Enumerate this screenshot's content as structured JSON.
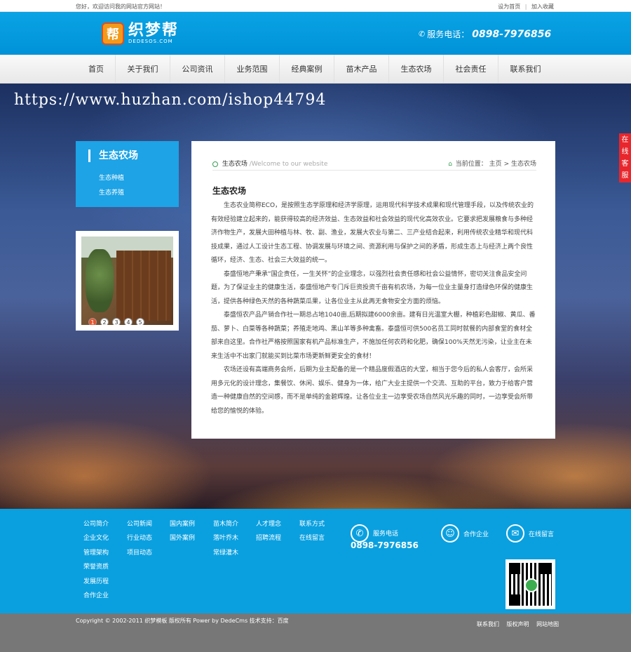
{
  "topbar": {
    "welcome": "您好，欢迎访问我的网站官方网站！",
    "set_home": "设为首页",
    "separator": "|",
    "add_favorite": "加入收藏"
  },
  "header": {
    "logo_mark": "帮",
    "logo_name": "织梦帮",
    "logo_domain": "DEDESOS.COM",
    "phone_label": "服务电话：",
    "phone_number": "0898-7976856"
  },
  "nav": {
    "items": [
      "首页",
      "关于我们",
      "公司资讯",
      "业务范围",
      "经典案例",
      "苗木产品",
      "生态农场",
      "社会责任",
      "联系我们"
    ]
  },
  "watermark": "https://www.huzhan.com/ishop44794",
  "sidebar": {
    "title": "生态农场",
    "items": [
      "生态种植",
      "生态养殖"
    ]
  },
  "slider": {
    "dots": [
      "1",
      "2",
      "3",
      "4",
      "5"
    ],
    "active": 1
  },
  "content": {
    "section_title": "生态农场",
    "section_subtitle": "/Welcome to our website",
    "location_label": "当前位置：",
    "crumb_home": "主页",
    "crumb_sep": ">",
    "crumb_current": "生态农场",
    "heading": "生态农场",
    "paragraphs": [
      "生态农业简称ECO，是按照生态学原理和经济学原理，运用现代科学技术成果和现代管理手段，以及传统农业的有效经验建立起来的，能获得较高的经济效益、生态效益和社会效益的现代化高效农业。它要求把发展粮食与多种经济作物生产，发展大田种植与林、牧、副、渔业，发展大农业与第二、三产业结合起来，利用传统农业精华和现代科技成果，通过人工设计生态工程、协调发展与环境之间、资源利用与保护之间的矛盾，形成生态上与经济上两个良性循环，经济、生态、社会三大效益的统一。",
      "泰盛恒地产秉承“国企责任，一生关怀”的企业理念，以强烈社会责任感和社会公益情怀，密切关注食品安全问题，为了保证业主的健康生活，泰盛恒地产专门斥巨资投资千亩有机农场，为每一位业主量身打造绿色环保的健康生活，提供各种绿色天然的各种蔬菜瓜果，让各位业主从此再无食物安全方面的烦恼。",
      "泰盛恒农产品产销合作社一期总占地1040亩,后期拟建6000余亩。建有日光温室大棚，种植彩色甜椒、黄瓜、番茄、萝卜、白菜等各种蔬菜；养殖走地鸡、黑山羊等多种禽畜。泰盛恒可供500名员工同时就餐的内部食堂的食材全部来自这里。合作社严格按照国家有机产品标准生产，不施加任何农药和化肥，确保100%天然无污染，让业主在未来生活中不出家门就能买到比菜市场更新鲜更安全的食材！",
      "农场还设有高端商务会所，后期为业主配备的是一个精品度假酒店的大堂，相当于您今后的私人会客厅，会所采用多元化的设计理念，集餐饮、休闲、娱乐、健身为一体，给广大业主提供一个交流、互助的平台，致力于给客户营造一种健康自然的空间感，而不是单纯的金碧辉煌。让各位业主一边享受农场自然风光乐趣的同时，一边享受会所带给您的愉悦的体验。"
    ]
  },
  "chat": "在线客服",
  "footer": {
    "col1": [
      "公司简介",
      "企业文化",
      "管理架构",
      "荣誉资质",
      "发展历程",
      "合作企业"
    ],
    "col2": [
      "公司新闻",
      "行业动态",
      "项目动态"
    ],
    "col3": [
      "国内案例",
      "国外案例"
    ],
    "col4": [
      "苗木简介",
      "落叶乔木",
      "常绿灌木"
    ],
    "col5": [
      "人才理念",
      "招聘流程"
    ],
    "col6": [
      "联系方式",
      "在线留言"
    ],
    "service_label": "服务电话",
    "service_number": "0898-7976856",
    "partner": "合作企业",
    "message": "在线留言"
  },
  "copyright": {
    "text": "Copyright © 2002-2011 织梦模板 版权所有 Power by DedeCms 技术支持：百度",
    "links": [
      "联系我们",
      "版权声明",
      "网站地图"
    ]
  },
  "colors": {
    "brand_blue": "#0aa0e0",
    "chat_red": "#e8262c",
    "footer_gray": "#777777"
  }
}
